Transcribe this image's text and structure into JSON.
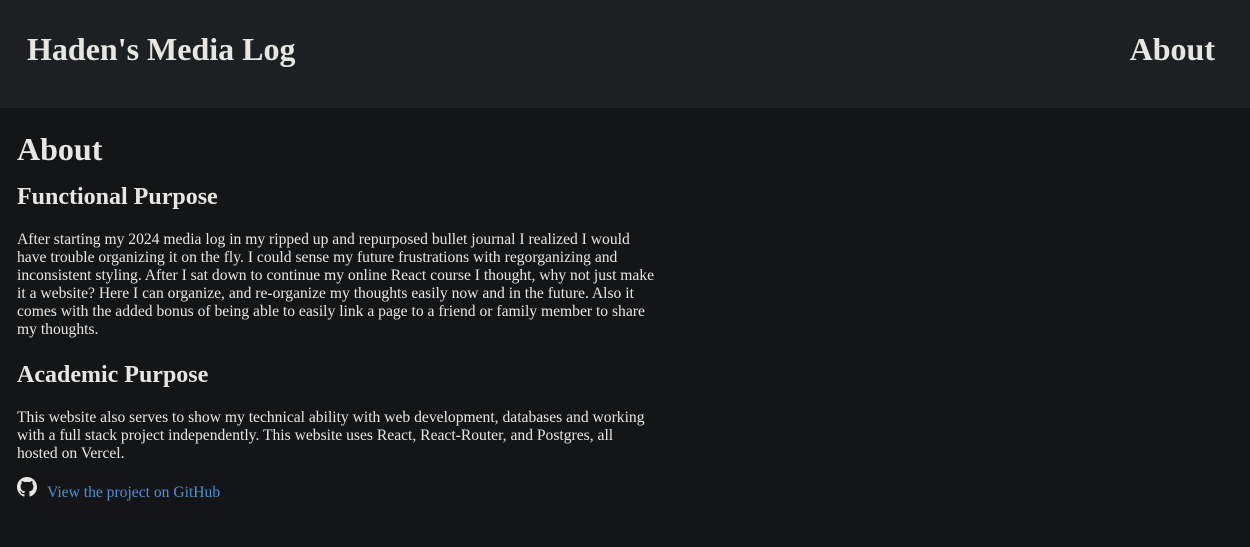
{
  "header": {
    "site_title": "Haden's Media Log",
    "nav_about": "About"
  },
  "main": {
    "page_heading": "About",
    "sections": [
      {
        "heading": "Functional Purpose",
        "text": "After starting my 2024 media log in my ripped up and repurposed bullet journal I realized I would have trouble organizing it on the fly. I could sense my future frustrations with regorganizing and inconsistent styling. After I sat down to continue my online React course I thought, why not just make it a website? Here I can organize, and re-organize my thoughts easily now and in the future. Also it comes with the added bonus of being able to easily link a page to a friend or family member to share my thoughts."
      },
      {
        "heading": "Academic Purpose",
        "text": "This website also serves to show my technical ability with web development, databases and working with a full stack project independently. This website uses React, React-Router, and Postgres, all hosted on Vercel."
      }
    ],
    "github_link": "View the project on GitHub",
    "github_icon": "github-icon"
  },
  "colors": {
    "background": "#141517",
    "header_background": "#1d2022",
    "text": "#e8e6e3",
    "link": "#4f8fd6"
  }
}
